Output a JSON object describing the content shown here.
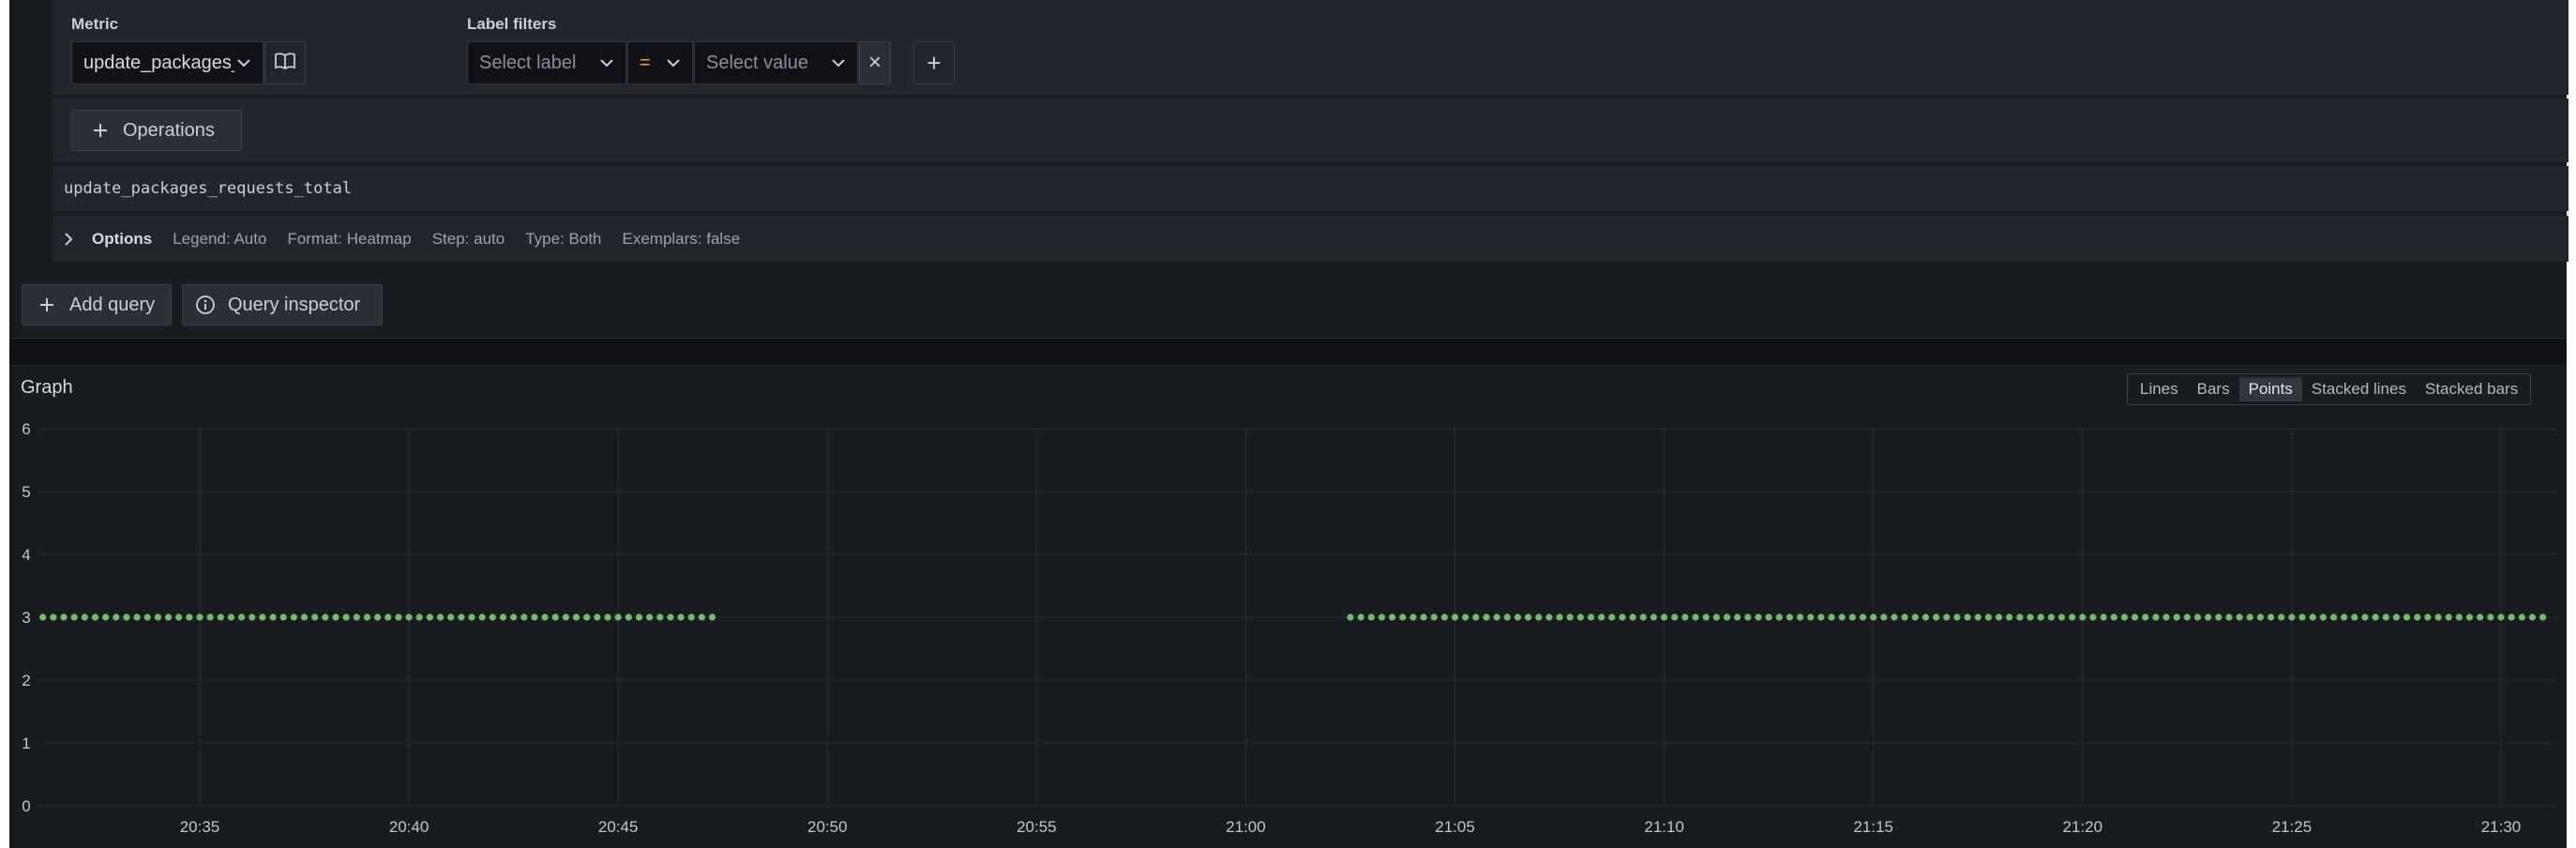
{
  "metric": {
    "label": "Metric",
    "value": "update_packages_requests_total"
  },
  "label_filters": {
    "label": "Label filters",
    "select_label_placeholder": "Select label",
    "operator": "=",
    "select_value_placeholder": "Select value",
    "remove_symbol": "×",
    "add_symbol": "+"
  },
  "operations": {
    "button_label": "Operations"
  },
  "raw_query": "update_packages_requests_total",
  "options": {
    "title": "Options",
    "items": [
      "Legend: Auto",
      "Format: Heatmap",
      "Step: auto",
      "Type: Both",
      "Exemplars: false"
    ]
  },
  "actions": {
    "add_query": "Add query",
    "query_inspector": "Query inspector"
  },
  "graph": {
    "title": "Graph",
    "view_modes": [
      "Lines",
      "Bars",
      "Points",
      "Stacked lines",
      "Stacked bars"
    ],
    "active_mode": "Points"
  },
  "colors": {
    "series": "#73bf69",
    "operator": "#ff9830",
    "background": "#181b1f"
  },
  "chart_data": {
    "type": "scatter",
    "y_ticks": [
      "0",
      "1",
      "2",
      "3",
      "4",
      "5",
      "6"
    ],
    "x_ticks": [
      "20:35",
      "20:40",
      "20:45",
      "20:50",
      "20:55",
      "21:00",
      "21:05",
      "21:10",
      "21:15",
      "21:20",
      "21:25",
      "21:30"
    ],
    "ylim": [
      0,
      6
    ],
    "grid": true,
    "series": [
      {
        "segments": [
          {
            "start": "20:31:15",
            "end": "20:47:15",
            "interval_seconds": 15,
            "value": 3
          },
          {
            "start": "21:02:30",
            "end": "21:31:00",
            "interval_seconds": 15,
            "value": 3
          }
        ]
      }
    ]
  }
}
